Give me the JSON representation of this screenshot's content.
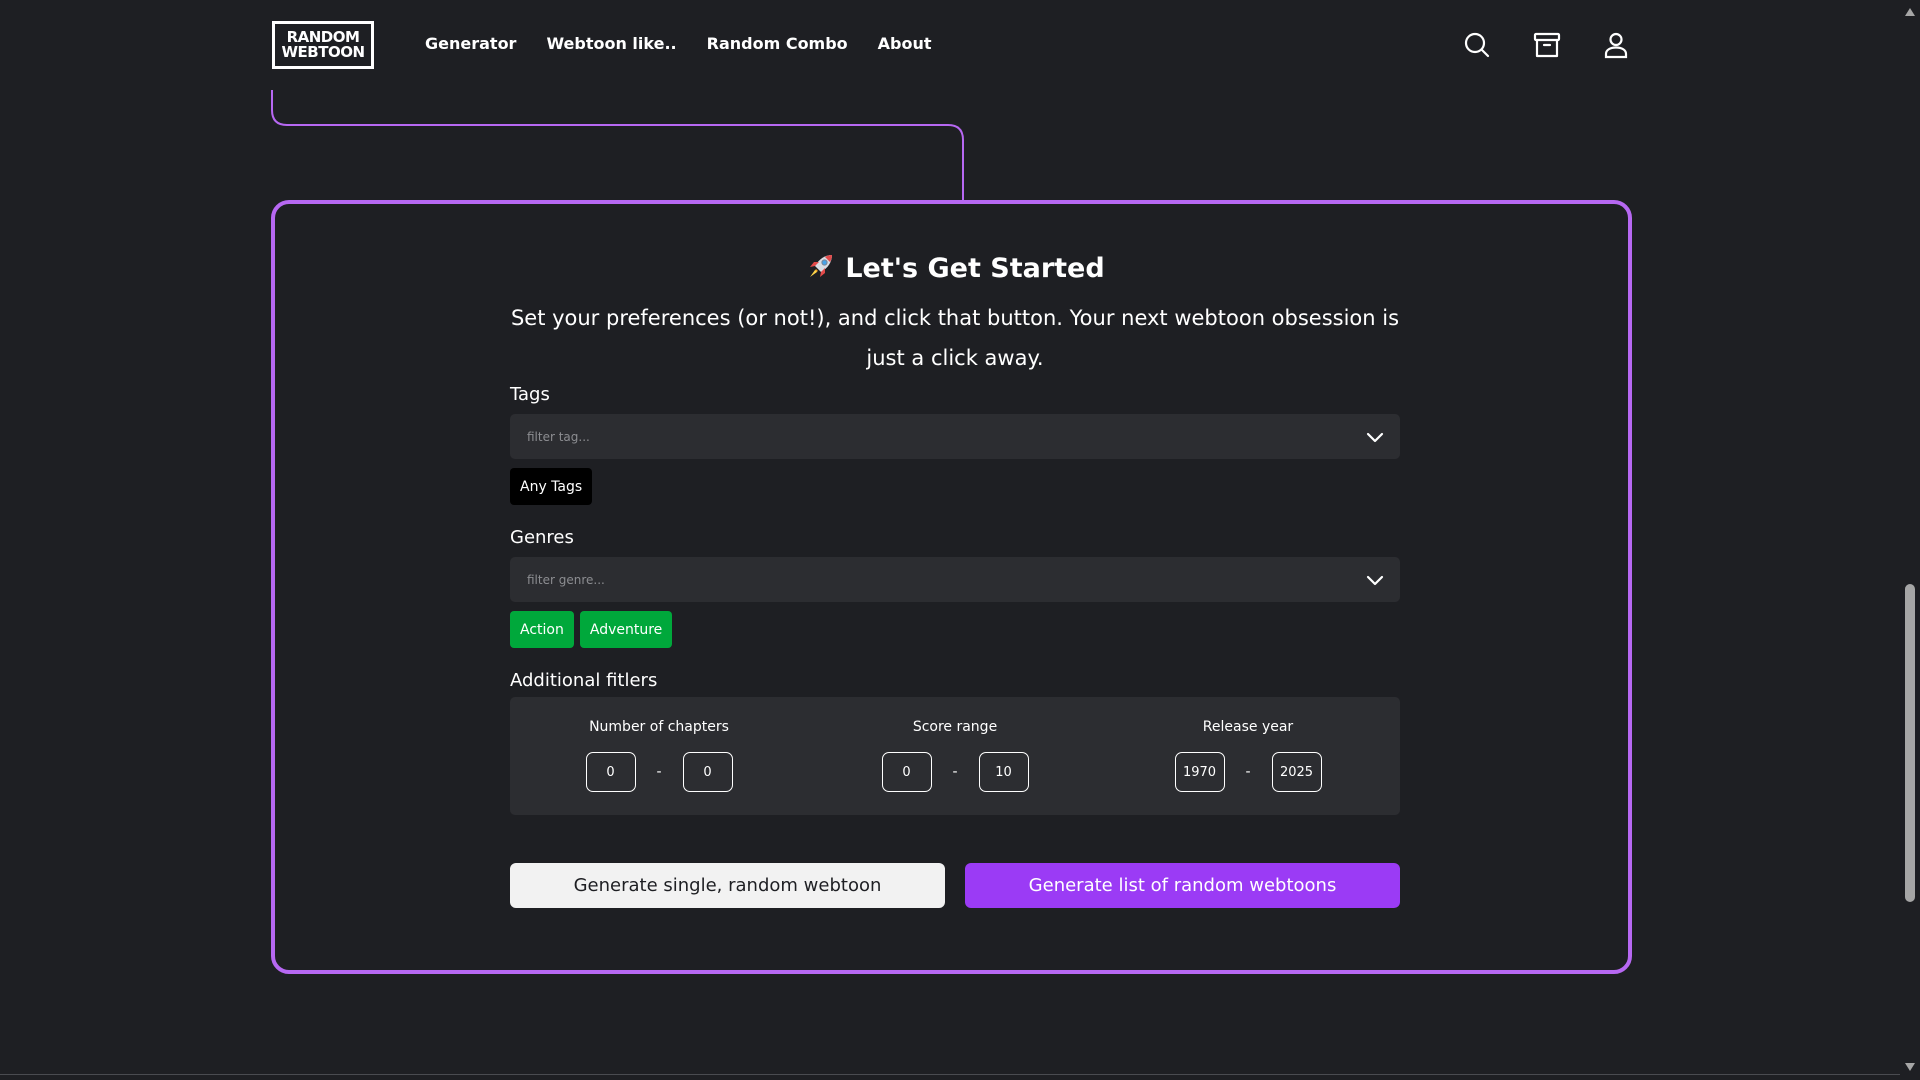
{
  "header": {
    "logo_line1": "RANDOM",
    "logo_line2": "WEBTOON",
    "nav": [
      {
        "label": "Generator"
      },
      {
        "label": "Webtoon like.."
      },
      {
        "label": "Random Combo"
      },
      {
        "label": "About"
      }
    ],
    "icons": [
      "search-icon",
      "archive-icon",
      "user-icon"
    ]
  },
  "card": {
    "title": "Let's Get Started",
    "title_icon": "rocket-icon",
    "description": "Set your preferences (or not!), and click that button. Your next webtoon obsession is just a click away.",
    "tags": {
      "label": "Tags",
      "placeholder": "filter tag...",
      "selected": [
        "Any Tags"
      ]
    },
    "genres": {
      "label": "Genres",
      "placeholder": "filter genre...",
      "selected": [
        "Action",
        "Adventure"
      ]
    },
    "additional": {
      "label": "Additional fitlers",
      "chapters": {
        "label": "Number of chapters",
        "min": "0",
        "max": "0"
      },
      "score": {
        "label": "Score range",
        "min": "0",
        "max": "10"
      },
      "year": {
        "label": "Release year",
        "min": "1970",
        "max": "2025"
      },
      "separator": "-"
    },
    "buttons": {
      "single": "Generate single, random webtoon",
      "list": "Generate list of random webtoons"
    }
  },
  "colors": {
    "background": "#1e1f23",
    "accent_border": "#b768f2",
    "primary_button": "#9b3bf5",
    "genre_chip": "#00a83b",
    "panel": "#2c2d31"
  }
}
